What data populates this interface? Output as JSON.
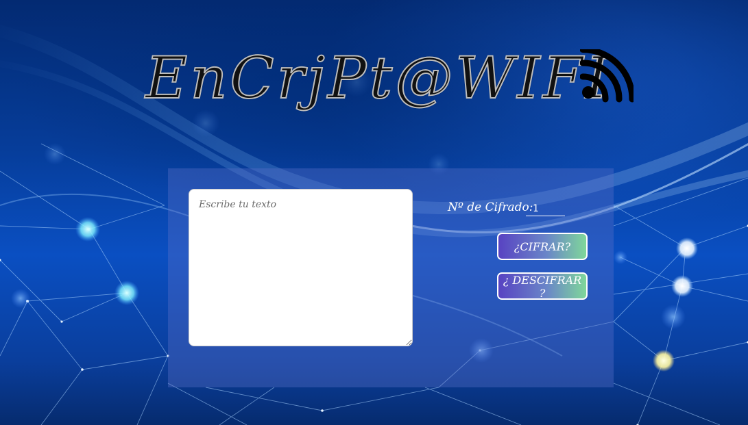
{
  "header": {
    "title": "EnCrjPt@WIFI",
    "icon": "wifi-rss-icon"
  },
  "form": {
    "textarea_placeholder": "Escribe tu texto",
    "textarea_value": "",
    "cipher_label": "Nº de Cifrado:",
    "cipher_value": "1",
    "encrypt_label": "¿CIFRAR?",
    "decrypt_label": "¿ DESCIFRAR ?"
  },
  "colors": {
    "background": "#0a4fc2",
    "panel": "#5a6ec8",
    "button_gradient_start": "#5843c2",
    "button_gradient_end": "#7fd79a",
    "button_border": "#ffffff"
  }
}
